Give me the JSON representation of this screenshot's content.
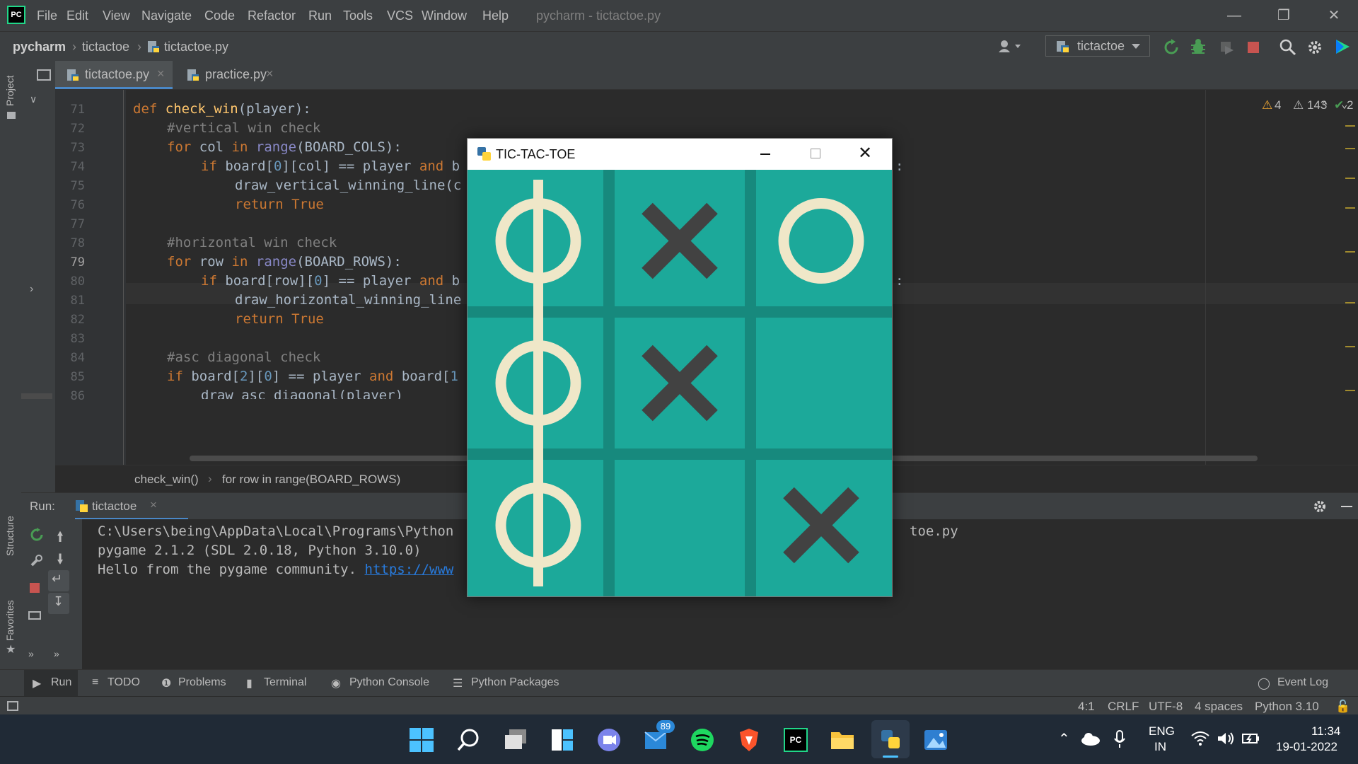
{
  "menubar": {
    "logo": "PC",
    "items": [
      "File",
      "Edit",
      "View",
      "Navigate",
      "Code",
      "Refactor",
      "Run",
      "Tools",
      "VCS",
      "Window",
      "Help"
    ],
    "title": "pycharm - tictactoe.py"
  },
  "navbar": {
    "project": "pycharm",
    "folder": "tictactoe",
    "file": "tictactoe.py",
    "run_config": "tictactoe"
  },
  "left_strip": {
    "project_label": "Project",
    "structure_label": "Structure",
    "favorites_label": "Favorites"
  },
  "editor_tabs": [
    {
      "label": "tictactoe.py",
      "active": true
    },
    {
      "label": "practice.py",
      "active": false
    }
  ],
  "inspections": {
    "warnings": "4",
    "weak_warnings": "143",
    "typos": "2"
  },
  "code_lines": [
    {
      "n": "71"
    },
    {
      "n": "72"
    },
    {
      "n": "73"
    },
    {
      "n": "74"
    },
    {
      "n": "75"
    },
    {
      "n": "76"
    },
    {
      "n": "77"
    },
    {
      "n": "78"
    },
    {
      "n": "79"
    },
    {
      "n": "80"
    },
    {
      "n": "81"
    },
    {
      "n": "82"
    },
    {
      "n": "83"
    },
    {
      "n": "84"
    },
    {
      "n": "85"
    },
    {
      "n": "86"
    }
  ],
  "code_text": {
    "l71_kw": "def",
    "l71_fn": "check_win",
    "l71_rest": "(player):",
    "l72": "#vertical win check",
    "l73_kw": "for",
    "l73_a": " col ",
    "l73_in": "in",
    "l73_sp": " ",
    "l73_bi": "range",
    "l73_rest": "(BOARD_COLS):",
    "l74_kw": "if",
    "l74_a": " board[",
    "l74_n": "0",
    "l74_b": "][col] == player ",
    "l74_and": "and",
    "l74_c": " b",
    "l74_tail": ":",
    "l75": "draw_vertical_winning_line(c",
    "l76_kw": "return",
    "l76_true": " True",
    "l78": "#horizontal win check",
    "l79_kw": "for",
    "l79_a": " row ",
    "l79_in": "in",
    "l79_sp": " ",
    "l79_bi": "range",
    "l79_rest": "(BOARD_ROWS):",
    "l80_kw": "if",
    "l80_a": " board[row][",
    "l80_n": "0",
    "l80_b": "] == player ",
    "l80_and": "and",
    "l80_c": " b",
    "l80_tail": ":",
    "l81": "draw_horizontal_winning_line",
    "l82_kw": "return",
    "l82_true": " True",
    "l84": "#asc diagonal check",
    "l85_kw": "if",
    "l85_a": " board[",
    "l85_n1": "2",
    "l85_b": "][",
    "l85_n2": "0",
    "l85_c": "] == player ",
    "l85_and": "and",
    "l85_d": " board[",
    "l85_n3": "1",
    "l86": "draw_asc_diagonal(player)"
  },
  "breadcrumb": {
    "func": "check_win()",
    "sep": "›",
    "stmt": "for row in range(BOARD_ROWS)"
  },
  "run_panel": {
    "label": "Run:",
    "tab": "tictactoe",
    "lines": [
      "C:\\Users\\being\\AppData\\Local\\Programs\\Python",
      "pygame 2.1.2 (SDL 2.0.18, Python 3.10.0)",
      "Hello from the pygame community. "
    ],
    "tail_right": "toe.py",
    "link": "https://www"
  },
  "tool_windows": [
    "Run",
    "TODO",
    "Problems",
    "Terminal",
    "Python Console",
    "Python Packages"
  ],
  "event_log": "Event Log",
  "status": {
    "pos": "4:1",
    "eol": "CRLF",
    "enc": "UTF-8",
    "indent": "4 spaces",
    "interp": "Python 3.10"
  },
  "taskbar": {
    "badge": "89",
    "lang1": "ENG",
    "lang2": "IN",
    "time": "11:34",
    "date": "19-01-2022"
  },
  "game": {
    "title": "TIC-TAC-TOE",
    "board": [
      [
        "O",
        "X",
        "O"
      ],
      [
        "O",
        "X",
        ""
      ],
      [
        "O",
        "",
        "X"
      ]
    ],
    "colors": {
      "bg": "#1ca99a",
      "grid": "#17897d",
      "o": "#efe7c8",
      "x": "#424242"
    }
  }
}
